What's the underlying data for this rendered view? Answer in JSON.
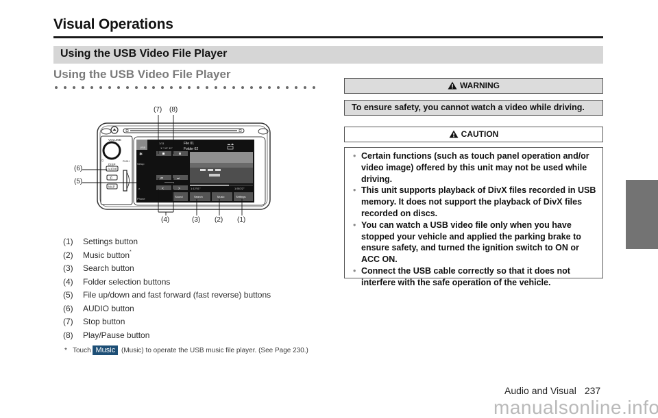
{
  "page": {
    "title": "Visual Operations",
    "section_title": "Using the USB Video File Player",
    "subsection_title": "Using the USB Video File Player",
    "dot_count": 30
  },
  "diagram": {
    "callouts": [
      "(7)",
      "(8)",
      "(6)",
      "(5)",
      "(4)",
      "(3)",
      "(2)",
      "(1)"
    ],
    "device": {
      "volume_label": "VOLUME",
      "push_label": "PUSH",
      "disp_label": "DISP",
      "audio_button": "AUDIO",
      "map_button": "MAP",
      "screen": {
        "source_tab": "USB",
        "setup_tab": "Setup",
        "phone_tab": "Phone",
        "track_count": "1/11",
        "elapsed_top": "1∷ 12' 11\"",
        "file_name": "File 01",
        "folder_name": "Folder 02",
        "elapsed": "1:12'51\"",
        "total": "1:55'22\"",
        "progress": 0.62,
        "buttons": [
          "Sound",
          "Search",
          "Music",
          "Settings"
        ]
      }
    }
  },
  "legend": [
    {
      "num": "(1)",
      "text": "Settings button",
      "footnote_mark": ""
    },
    {
      "num": "(2)",
      "text": "Music button",
      "footnote_mark": "*"
    },
    {
      "num": "(3)",
      "text": "Search button",
      "footnote_mark": ""
    },
    {
      "num": "(4)",
      "text": "Folder selection buttons",
      "footnote_mark": ""
    },
    {
      "num": "(5)",
      "text": "File up/down and fast forward (fast reverse) buttons",
      "footnote_mark": ""
    },
    {
      "num": "(6)",
      "text": "AUDIO button",
      "footnote_mark": ""
    },
    {
      "num": "(7)",
      "text": "Stop button",
      "footnote_mark": ""
    },
    {
      "num": "(8)",
      "text": "Play/Pause button",
      "footnote_mark": ""
    }
  ],
  "footnote": {
    "star": "*",
    "prefix": "Touch",
    "badge": "Music",
    "suffix": "(Music) to operate the USB music file player. (See Page 230.)",
    "badge_color": "#1e4f76"
  },
  "warning": {
    "heading": "WARNING",
    "text": "To ensure safety, you cannot watch a video while driving."
  },
  "caution": {
    "heading": "CAUTION",
    "items": [
      "Certain functions (such as touch panel operation and/or video image) offered by this unit may not be used while driving.",
      "This unit supports playback of DivX files recorded in USB memory. It does not support the playback of DivX files recorded on discs.",
      "You can watch a USB video file only when you have stopped your vehicle and applied the parking brake to ensure safety, and turned the ignition switch to ON or ACC ON.",
      "Connect the USB cable correctly so that it does not interfere with the safe operation of the vehicle."
    ],
    "bullet": "•"
  },
  "footer": {
    "section": "Audio and Visual",
    "page_number": "237"
  },
  "watermark": "manualsonline.info"
}
